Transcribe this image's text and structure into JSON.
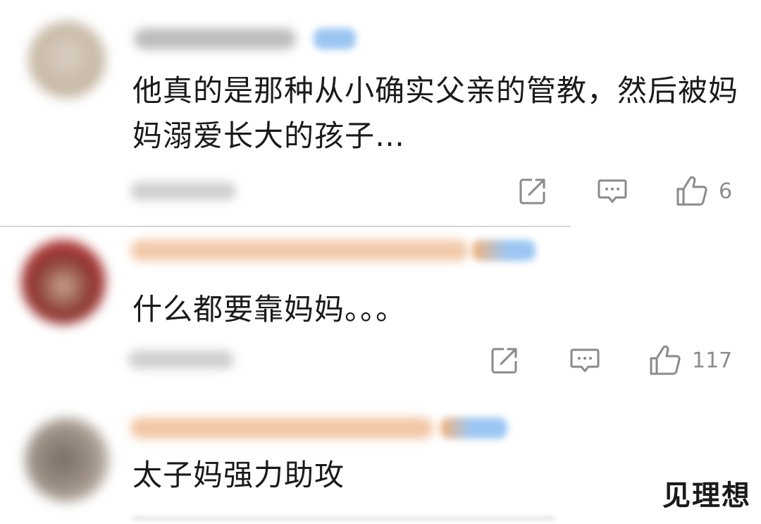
{
  "comments": [
    {
      "text": "他真的是那种从小确实父亲的管教，然后被妈妈溺爱长大的孩子…",
      "likes": "6"
    },
    {
      "text": "什么都要靠妈妈。。。",
      "likes": "117"
    },
    {
      "text": "太子妈强力助攻"
    }
  ],
  "watermark": "见理想",
  "icons": {
    "share": "share-icon",
    "comment": "comment-icon",
    "like": "thumbs-up-icon"
  },
  "colors": {
    "text": "#1a1a1a",
    "icon": "#888888",
    "divider": "#d6d6d6"
  }
}
